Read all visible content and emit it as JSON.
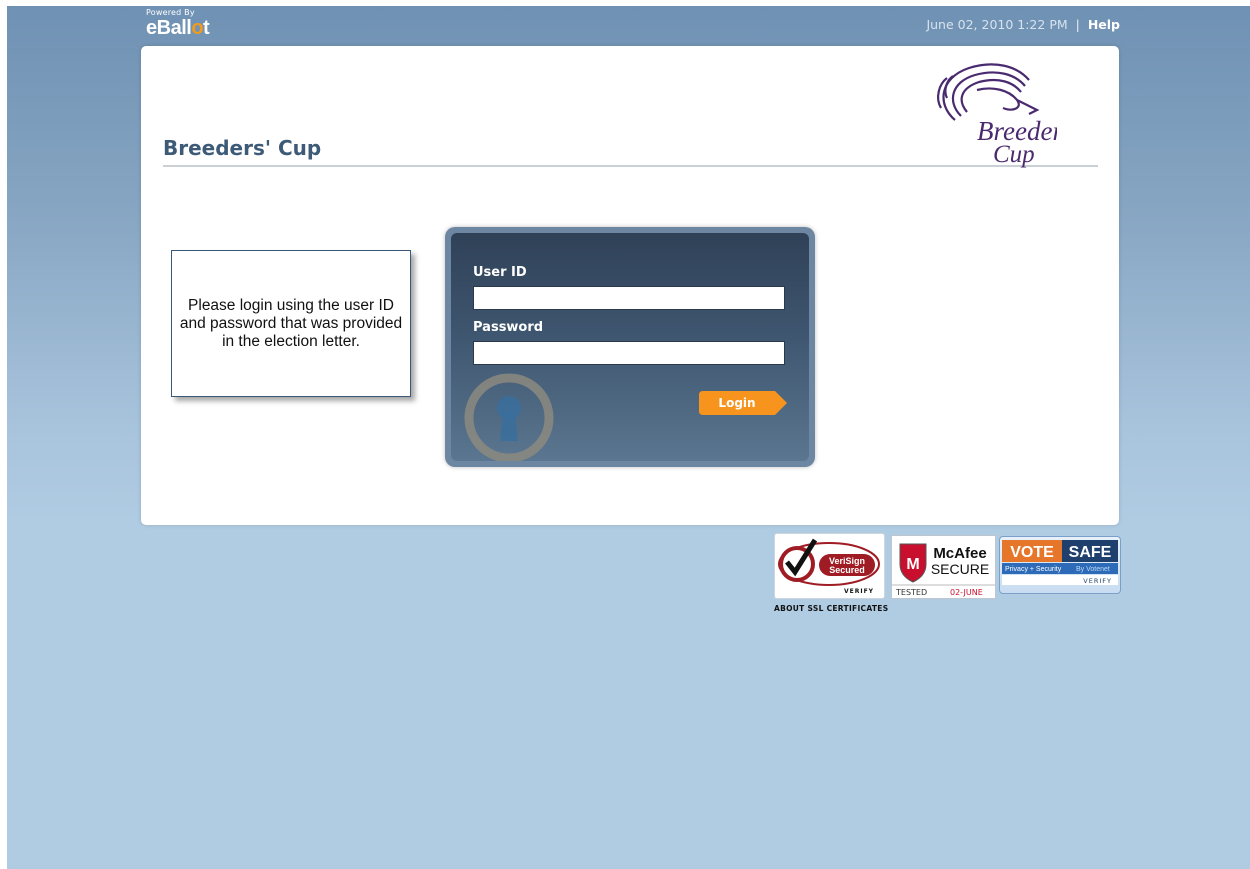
{
  "brand": {
    "powered_by": "Powered By",
    "name_prefix": "eBall",
    "name_dot": "o",
    "name_suffix": "t"
  },
  "header": {
    "datetime": "June 02, 2010 1:22 PM",
    "separator": "|",
    "help": "Help"
  },
  "page": {
    "title": "Breeders' Cup",
    "logo_main": "Breeders'",
    "logo_sub": "Cup"
  },
  "notice": {
    "text": "Please login using the user ID and password that was provided in the election letter."
  },
  "login": {
    "user_id_label": "User ID",
    "user_id_value": "",
    "password_label": "Password",
    "password_value": "",
    "button_label": "Login"
  },
  "badges": {
    "verisign_line1": "VeriSign",
    "verisign_line2": "Secured",
    "verisign_verify": "VERIFY",
    "mcafee_name": "McAfee",
    "mcafee_secure": "SECURE",
    "mcafee_tested": "TESTED",
    "mcafee_date": "02-JUNE",
    "votesafe_vote": "VOTE",
    "votesafe_safe": "SAFE",
    "votesafe_tagline": "Privacy + Security",
    "votesafe_by": "By Votenet",
    "votesafe_verify": "VERIFY",
    "ssl_link": "ABOUT SSL CERTIFICATES"
  },
  "colors": {
    "accent": "#f39a1c",
    "title": "#3d5a77",
    "logo_purple": "#4a2a6e"
  }
}
